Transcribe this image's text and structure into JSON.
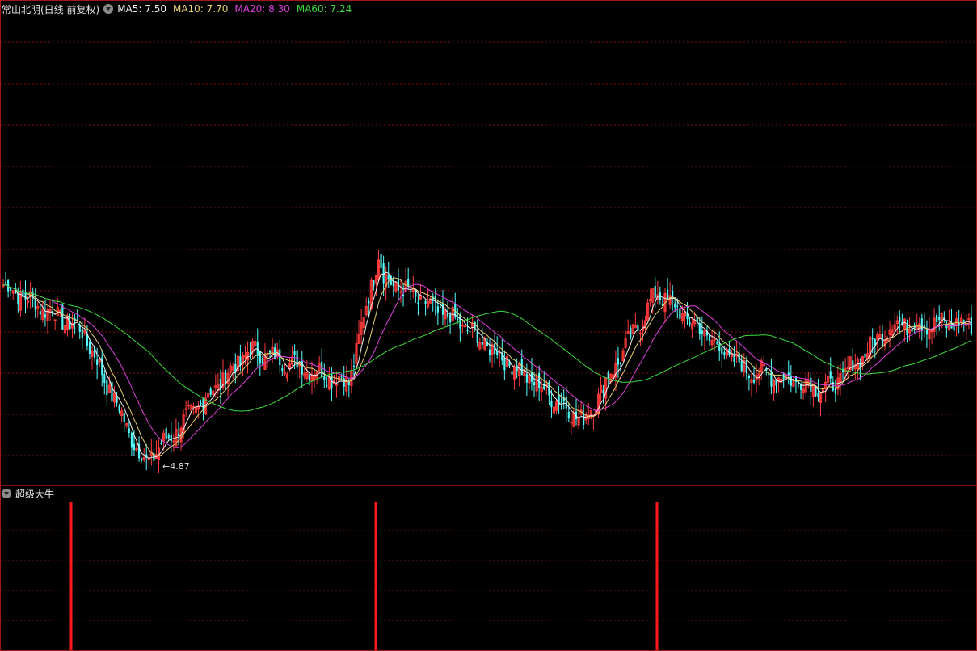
{
  "header": {
    "title": "常山北明(日线 前复权)",
    "ma5": "MA5: 7.50",
    "ma10": "MA10: 7.70",
    "ma20": "MA20: 8.30",
    "ma60": "MA60: 7.24"
  },
  "indicator": {
    "title": "超级大牛",
    "signals": [
      88,
      465,
      813
    ]
  },
  "low_marker": {
    "label": "4.87",
    "arrow": "←"
  },
  "colors": {
    "background": "#000000",
    "grid": "#7a1010",
    "frame": "#a01818",
    "candle_up": "#ff3b3b",
    "candle_down": "#54ffff",
    "ma5": "#f0f0f0",
    "ma10": "#e8d070",
    "ma20": "#e040e0",
    "ma60": "#3cdc3c",
    "signal": "#ff1a1a"
  },
  "chart_data": {
    "type": "candlestick",
    "key_prices": [
      {
        "bar": 0,
        "close": 7.6
      },
      {
        "bar": 32,
        "close": 6.9
      },
      {
        "bar": 55,
        "close": 5.0
      },
      {
        "bar": 58,
        "low": 4.87
      },
      {
        "bar": 100,
        "close": 6.6
      },
      {
        "bar": 140,
        "close": 6.1
      },
      {
        "bar": 152,
        "high": 8.1
      },
      {
        "bar": 154,
        "close": 7.7
      },
      {
        "bar": 185,
        "close": 7.0
      },
      {
        "bar": 235,
        "close": 5.5
      },
      {
        "bar": 265,
        "close": 7.5
      },
      {
        "bar": 300,
        "close": 6.3
      },
      {
        "bar": 335,
        "close": 6.0
      },
      {
        "bar": 360,
        "close": 7.0
      },
      {
        "bar": 392,
        "close": 7.0
      }
    ],
    "ma_last": {
      "MA5": 7.5,
      "MA10": 7.7,
      "MA20": 8.3,
      "MA60": 7.24
    }
  }
}
